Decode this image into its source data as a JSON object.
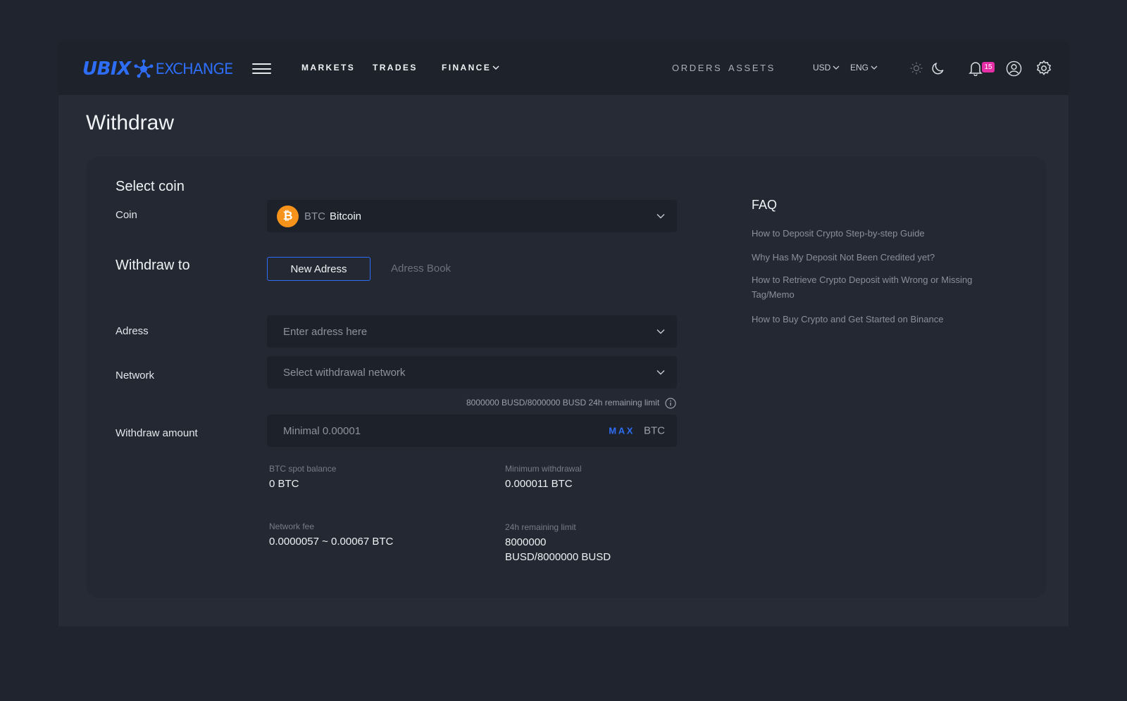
{
  "brand": {
    "logo_main": "UBIX",
    "logo_sub": "EXCHANGE"
  },
  "nav": {
    "markets": "MARKETS",
    "trades": "TRADES",
    "finance": "FINANCE",
    "orders": "ORDERS",
    "assets": "ASSETS",
    "currency": "USD",
    "language": "ENG",
    "notification_count": "15"
  },
  "page": {
    "title": "Withdraw"
  },
  "form": {
    "select_coin_title": "Select coin",
    "coin_label": "Coin",
    "coin_ticker": "BTC",
    "coin_name": "Bitcoin",
    "coin_symbol": "₿",
    "withdraw_to_title": "Withdraw to",
    "tab_new": "New Adress",
    "tab_book": "Adress Book",
    "address_label": "Adress",
    "address_placeholder": "Enter adress here",
    "network_label": "Network",
    "network_placeholder": "Select withdrawal network",
    "limit_note": "8000000 BUSD/8000000 BUSD 24h remaining limit",
    "amount_label": "Withdraw amount",
    "amount_placeholder": "Minimal 0.00001",
    "max_label": "MAX",
    "amount_unit": "BTC"
  },
  "stats": {
    "spot_balance_label": "BTC spot balance",
    "spot_balance_value": "0 BTC",
    "min_withdrawal_label": "Minimum withdrawal",
    "min_withdrawal_value": "0.000011 BTC",
    "network_fee_label": "Network fee",
    "network_fee_value": "0.0000057 ~ 0.00067 BTC",
    "remaining_limit_label": "24h remaining limit",
    "remaining_limit_line1": "8000000",
    "remaining_limit_line2": "BUSD/8000000 BUSD"
  },
  "faq": {
    "title": "FAQ",
    "items": [
      "How to Deposit Crypto Step-by-step Guide",
      "Why Has My Deposit Not Been Credited yet?",
      "How to Retrieve Crypto Deposit with Wrong or Missing Tag/Memo",
      "How to Buy Crypto and Get Started on Binance"
    ]
  },
  "colors": {
    "accent": "#2e6df5",
    "badge": "#e62ea6",
    "bitcoin": "#f7931a",
    "background": "#1f242e"
  }
}
